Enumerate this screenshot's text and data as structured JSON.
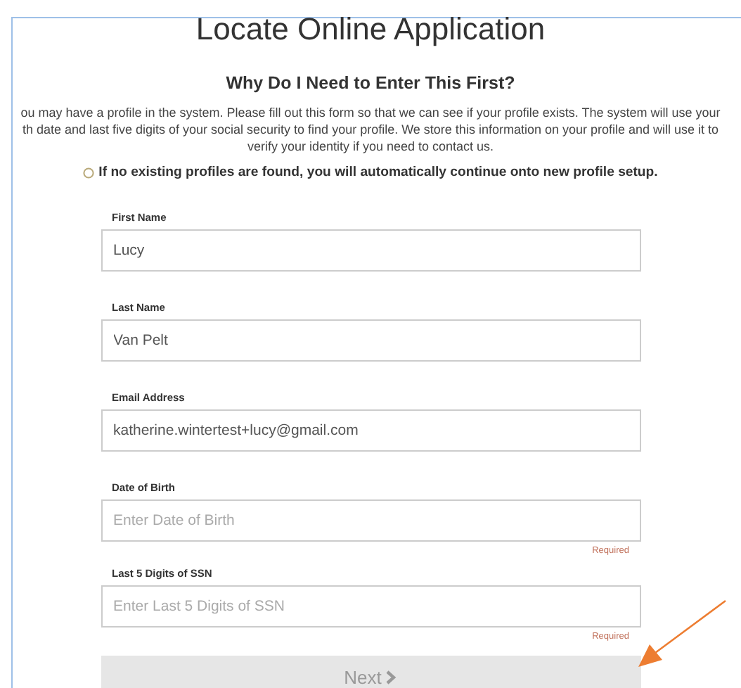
{
  "title": "Locate Online Application",
  "heading": "Why Do I Need to Enter This First?",
  "explanation_lines": [
    "ou may have a profile in the system. Please fill out this form so that we can see if your profile exists. The system will use your",
    "th date and last five digits of your social security to find your profile. We store this information on your profile and will use it to",
    "verify your identity if you need to contact us."
  ],
  "notice": "If no existing profiles are found, you will automatically continue onto new profile setup.",
  "fields": [
    {
      "label": "First Name",
      "kind": "value",
      "text": "Lucy",
      "required": false
    },
    {
      "label": "Last Name",
      "kind": "value",
      "text": "Van Pelt",
      "required": false
    },
    {
      "label": "Email Address",
      "kind": "value",
      "text": "katherine.wintertest+lucy@gmail.com",
      "required": false
    },
    {
      "label": "Date of Birth",
      "kind": "placeholder",
      "placeholder": "Enter Date of Birth",
      "required": true,
      "required_text": "Required"
    },
    {
      "label": "Last 5 Digits of SSN",
      "kind": "placeholder",
      "placeholder": "Enter Last 5 Digits of SSN",
      "required": true,
      "required_text": "Required"
    }
  ],
  "next_button": {
    "label": "Next",
    "disabled": true
  }
}
